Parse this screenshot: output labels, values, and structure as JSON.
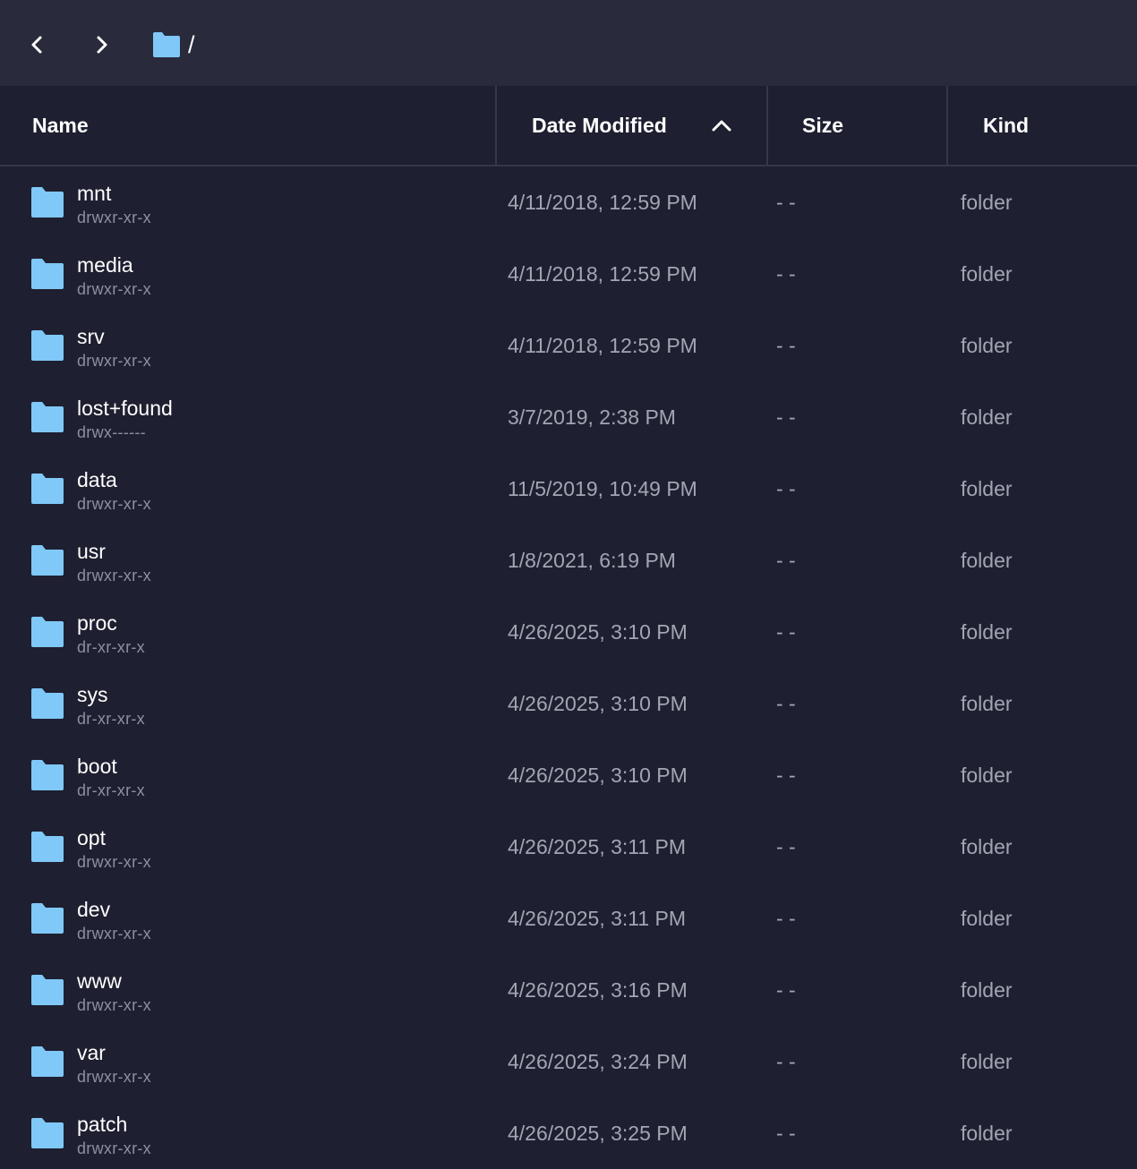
{
  "toolbar": {
    "back_icon": "chevron-left-icon",
    "forward_icon": "chevron-right-icon",
    "path_icon": "folder-icon",
    "path": "/"
  },
  "columns": {
    "name": "Name",
    "date_modified": "Date Modified",
    "size": "Size",
    "kind": "Kind",
    "sort_icon": "chevron-up-icon"
  },
  "colors": {
    "background": "#1e1f30",
    "toolbar": "#292b3c",
    "folder_icon": "#7fc8f8",
    "secondary_text": "#a3a5b3"
  },
  "files": [
    {
      "name": "mnt",
      "perm": "drwxr-xr-x",
      "date": "4/11/2018, 12:59 PM",
      "size": "- -",
      "kind": "folder"
    },
    {
      "name": "media",
      "perm": "drwxr-xr-x",
      "date": "4/11/2018, 12:59 PM",
      "size": "- -",
      "kind": "folder"
    },
    {
      "name": "srv",
      "perm": "drwxr-xr-x",
      "date": "4/11/2018, 12:59 PM",
      "size": "- -",
      "kind": "folder"
    },
    {
      "name": "lost+found",
      "perm": "drwx------",
      "date": "3/7/2019, 2:38 PM",
      "size": "- -",
      "kind": "folder"
    },
    {
      "name": "data",
      "perm": "drwxr-xr-x",
      "date": "11/5/2019, 10:49 PM",
      "size": "- -",
      "kind": "folder"
    },
    {
      "name": "usr",
      "perm": "drwxr-xr-x",
      "date": "1/8/2021, 6:19 PM",
      "size": "- -",
      "kind": "folder"
    },
    {
      "name": "proc",
      "perm": "dr-xr-xr-x",
      "date": "4/26/2025, 3:10 PM",
      "size": "- -",
      "kind": "folder"
    },
    {
      "name": "sys",
      "perm": "dr-xr-xr-x",
      "date": "4/26/2025, 3:10 PM",
      "size": "- -",
      "kind": "folder"
    },
    {
      "name": "boot",
      "perm": "dr-xr-xr-x",
      "date": "4/26/2025, 3:10 PM",
      "size": "- -",
      "kind": "folder"
    },
    {
      "name": "opt",
      "perm": "drwxr-xr-x",
      "date": "4/26/2025, 3:11 PM",
      "size": "- -",
      "kind": "folder"
    },
    {
      "name": "dev",
      "perm": "drwxr-xr-x",
      "date": "4/26/2025, 3:11 PM",
      "size": "- -",
      "kind": "folder"
    },
    {
      "name": "www",
      "perm": "drwxr-xr-x",
      "date": "4/26/2025, 3:16 PM",
      "size": "- -",
      "kind": "folder"
    },
    {
      "name": "var",
      "perm": "drwxr-xr-x",
      "date": "4/26/2025, 3:24 PM",
      "size": "- -",
      "kind": "folder"
    },
    {
      "name": "patch",
      "perm": "drwxr-xr-x",
      "date": "4/26/2025, 3:25 PM",
      "size": "- -",
      "kind": "folder"
    }
  ]
}
